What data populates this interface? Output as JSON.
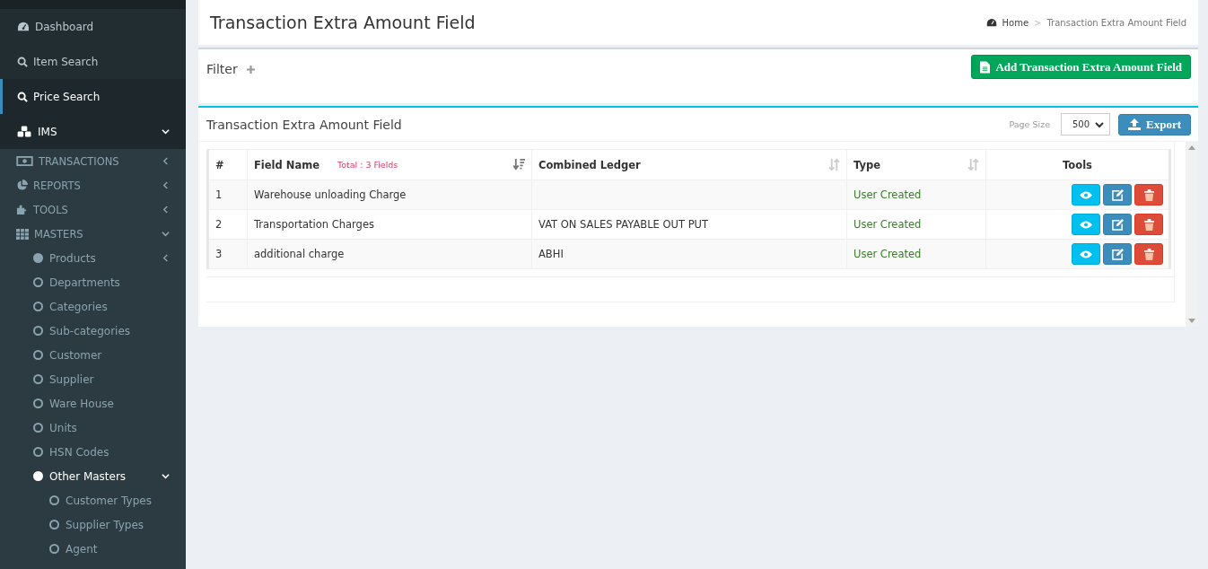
{
  "sidebar": {
    "items": [
      {
        "label": "Dashboard",
        "selected": false
      },
      {
        "label": "Item Search",
        "selected": false
      },
      {
        "label": "Price Search",
        "selected": true
      },
      {
        "label": "IMS",
        "selected": false,
        "expanded": true,
        "children": [
          {
            "label": "TRANSACTIONS",
            "selected": false,
            "expanded": false
          },
          {
            "label": "REPORTS",
            "selected": false,
            "expanded": false
          },
          {
            "label": "TOOLS",
            "selected": false,
            "expanded": false
          },
          {
            "label": "MASTERS",
            "selected": false,
            "expanded": true,
            "children": [
              {
                "label": "Products",
                "selected": false,
                "expanded": false
              },
              {
                "label": "Departments",
                "selected": false
              },
              {
                "label": "Categories",
                "selected": false
              },
              {
                "label": "Sub-categories",
                "selected": false
              },
              {
                "label": "Customer",
                "selected": false
              },
              {
                "label": "Supplier",
                "selected": false
              },
              {
                "label": "Ware House",
                "selected": false
              },
              {
                "label": "Units",
                "selected": false
              },
              {
                "label": "HSN Codes",
                "selected": false
              },
              {
                "label": "Other Masters",
                "selected": true,
                "expanded": true,
                "children": [
                  {
                    "label": "Customer Types",
                    "selected": false
                  },
                  {
                    "label": "Supplier Types",
                    "selected": false
                  },
                  {
                    "label": "Agent",
                    "selected": false
                  }
                ]
              }
            ]
          }
        ]
      }
    ]
  },
  "header": {
    "title": "Transaction Extra Amount Field",
    "breadcrumb": [
      "Home",
      "Transaction Extra Amount Field"
    ],
    "breadcrumb_separator": ">"
  },
  "filter": {
    "label": "Filter",
    "add_button": "Add Transaction Extra Amount Field"
  },
  "table_panel": {
    "title": "Transaction Extra Amount Field",
    "page_size_label": "Page Size",
    "page_size": "500",
    "export_button": "Export"
  },
  "table": {
    "columns": [
      {
        "label": "#",
        "sortable": false
      },
      {
        "label": "Field Name",
        "sortable": true,
        "note": "Total : 3 Fields"
      },
      {
        "label": "Combined Ledger",
        "sortable": true
      },
      {
        "label": "Type",
        "sortable": true
      },
      {
        "label": "Tools",
        "sortable": false
      }
    ],
    "rows": [
      {
        "number": "1",
        "field_name": "Warehouse unloading Charge",
        "combined_ledger": "",
        "type": "User Created"
      },
      {
        "number": "2",
        "field_name": "Transportation Charges",
        "combined_ledger": "VAT ON SALES PAYABLE OUT PUT",
        "type": "User Created"
      },
      {
        "number": "3",
        "field_name": "additional charge",
        "combined_ledger": "ABHI",
        "type": "User Created"
      }
    ]
  }
}
